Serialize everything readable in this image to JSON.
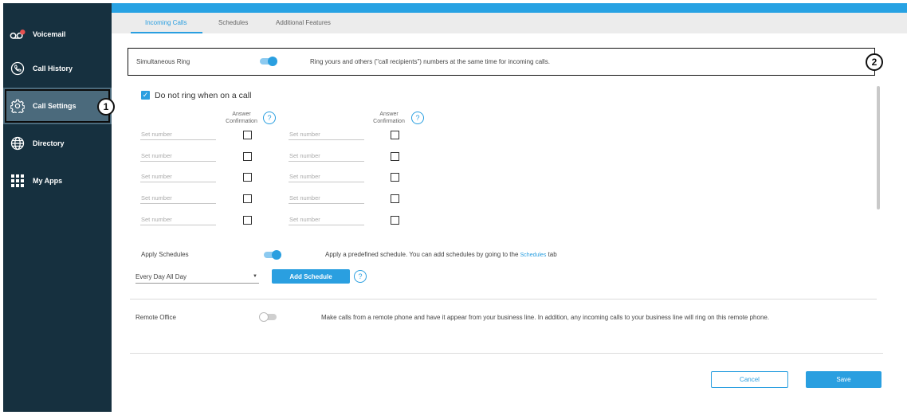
{
  "sidebar": {
    "items": [
      {
        "label": "Voicemail",
        "icon": "voicemail-icon",
        "badge_color": "#e8504f"
      },
      {
        "label": "Call History",
        "icon": "phone-history-icon"
      },
      {
        "label": "Call Settings",
        "icon": "gear-icon"
      },
      {
        "label": "Directory",
        "icon": "globe-icon"
      },
      {
        "label": "My Apps",
        "icon": "grid-icon"
      }
    ],
    "active": "Call Settings"
  },
  "callouts": {
    "one": "1",
    "two": "2"
  },
  "tabs": [
    "Incoming Calls",
    "Schedules",
    "Additional Features"
  ],
  "active_tab": "Incoming Calls",
  "simultaneous_ring": {
    "label": "Simultaneous Ring",
    "enabled": true,
    "description": "Ring yours and others (\"call recipients\") numbers at the same time for incoming calls."
  },
  "do_not_ring": {
    "label": "Do not ring when on a call",
    "checked": true
  },
  "answer_confirmation": {
    "line1": "Answer",
    "line2": "Confirmation",
    "help": "?"
  },
  "set_number_placeholder": "Set number",
  "apply_schedules": {
    "label": "Apply Schedules",
    "enabled": true,
    "description_prefix": "Apply a predefined schedule. You can add schedules by going to the",
    "link_text": "Schedules",
    "description_suffix": "tab",
    "selected_schedule": "Every Day All Day",
    "add_button": "Add Schedule",
    "help": "?"
  },
  "remote_office": {
    "label": "Remote Office",
    "enabled": false,
    "description": "Make calls from a remote phone and have it appear from your business line. In addition, any incoming calls to your business line will ring on this remote phone."
  },
  "footer": {
    "cancel": "Cancel",
    "save": "Save"
  },
  "colors": {
    "sidebar": "#16303f",
    "accent": "#2a9fe0",
    "active_nav": "#4b6a7c"
  }
}
